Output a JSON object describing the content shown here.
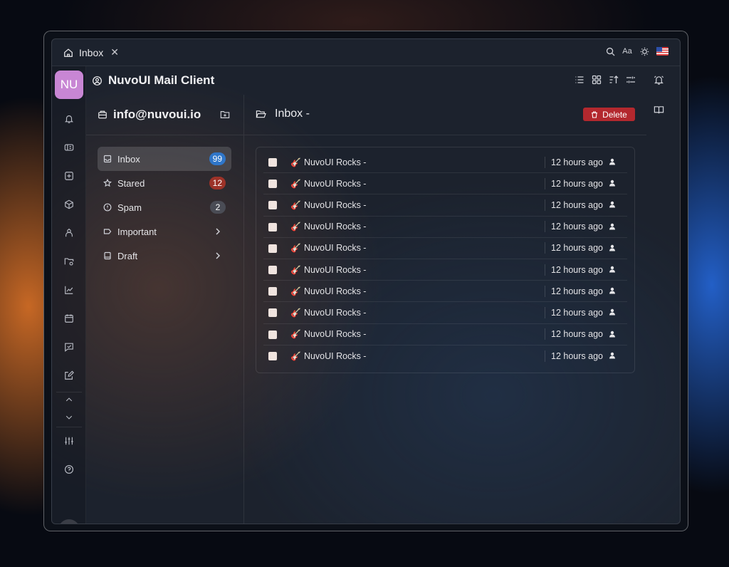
{
  "tab": {
    "title": "Inbox"
  },
  "top_icons": [
    "search-icon",
    "font-size-icon",
    "theme-sun-icon",
    "us-flag-icon"
  ],
  "rail": {
    "logo": "NU",
    "avatar": "NU"
  },
  "app": {
    "title": "NuvoUI Mail Client"
  },
  "mailbox": {
    "account": "info@nuvoui.io"
  },
  "folders": [
    {
      "label": "Inbox",
      "badge": "99",
      "badge_color": "#2f76c9"
    },
    {
      "label": "Stared",
      "badge": "12",
      "badge_color": "#9c3228"
    },
    {
      "label": "Spam",
      "badge": "2",
      "badge_color": "#4a4c55"
    },
    {
      "label": "Important"
    },
    {
      "label": "Draft"
    }
  ],
  "main": {
    "title": "Inbox -",
    "delete_label": "Delete"
  },
  "messages": [
    {
      "subject": "NuvoUI Rocks -",
      "time": "12 hours ago"
    },
    {
      "subject": "NuvoUI Rocks -",
      "time": "12 hours ago"
    },
    {
      "subject": "NuvoUI Rocks -",
      "time": "12 hours ago"
    },
    {
      "subject": "NuvoUI Rocks -",
      "time": "12 hours ago"
    },
    {
      "subject": "NuvoUI Rocks -",
      "time": "12 hours ago"
    },
    {
      "subject": "NuvoUI Rocks -",
      "time": "12 hours ago"
    },
    {
      "subject": "NuvoUI Rocks -",
      "time": "12 hours ago"
    },
    {
      "subject": "NuvoUI Rocks -",
      "time": "12 hours ago"
    },
    {
      "subject": "NuvoUI Rocks -",
      "time": "12 hours ago"
    },
    {
      "subject": "NuvoUI Rocks -",
      "time": "12 hours ago"
    }
  ]
}
